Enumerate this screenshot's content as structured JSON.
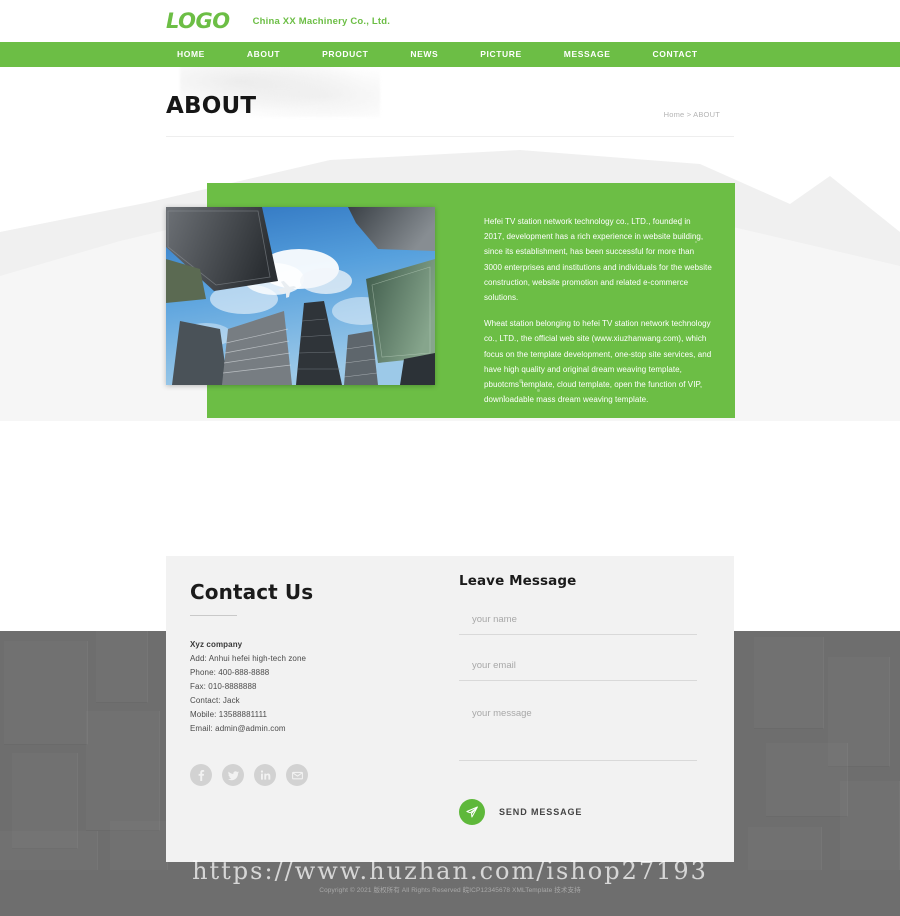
{
  "brand": {
    "logo_text": "LOGO",
    "company_name": "China XX Machinery Co., Ltd.",
    "accent_color": "#6CBE45",
    "dark_band_color": "#6e6e6e",
    "panel_color": "#f2f2f2"
  },
  "nav": {
    "items": [
      {
        "label": "HOME"
      },
      {
        "label": "ABOUT"
      },
      {
        "label": "PRODUCT"
      },
      {
        "label": "NEWS"
      },
      {
        "label": "PICTURE"
      },
      {
        "label": "MESSAGE"
      },
      {
        "label": "CONTACT"
      }
    ]
  },
  "hero": {
    "title": "ABOUT",
    "breadcrumb": "Home > ABOUT"
  },
  "about": {
    "image_alt": "skyscrapers-looking-up-photo",
    "paragraphs": [
      "Hefei TV station network technology co., LTD., founded in 2017, development has a rich experience in website building, since its establishment, has been successful for more than 3000 enterprises and institutions and individuals for the website construction, website promotion and related e-commerce solutions.",
      "Wheat station belonging to hefei TV station network technology co., LTD., the official web site (www.xiuzhanwang.com), which focus on the template development, one-stop site services, and have high quality and original dream weaving template, pbuotcms template, cloud template, open the function of VIP, downloadable mass dream weaving template."
    ]
  },
  "contact": {
    "title": "Contact Us",
    "company": "Xyz company",
    "lines": [
      "Add: Anhui hefei high-tech zone",
      "Phone: 400-888-8888",
      "Fax: 010-8888888",
      "Contact: Jack",
      "Mobile: 13588881111",
      "Email: admin@admin.com"
    ],
    "socials": [
      {
        "name": "facebook-icon"
      },
      {
        "name": "twitter-icon"
      },
      {
        "name": "linkedin-icon"
      },
      {
        "name": "email-icon"
      }
    ]
  },
  "form": {
    "title": "Leave Message",
    "name_placeholder": "your name",
    "email_placeholder": "your email",
    "message_placeholder": "your message",
    "name_value": "",
    "email_value": "",
    "message_value": "",
    "send_label": "SEND MESSAGE",
    "send_icon": "paper-plane-icon",
    "send_button_color": "#5EB83A"
  },
  "footer": {
    "copyright": "Copyright © 2021 版权所有 All Rights Reserved  皖ICP12345678  XMLTemplate  技术支持"
  },
  "watermark": {
    "text": "https://www.huzhan.com/ishop27193"
  }
}
